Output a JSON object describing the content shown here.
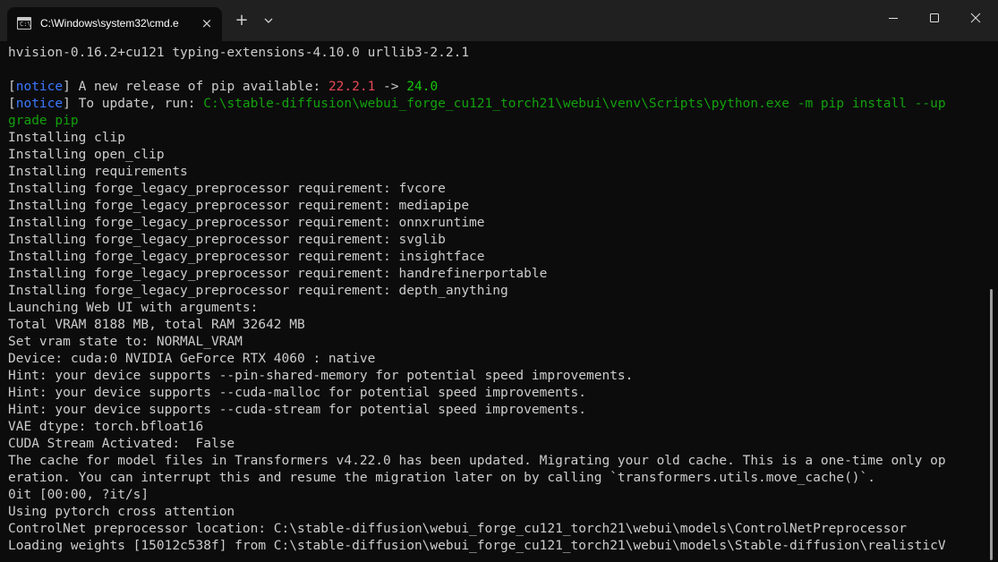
{
  "titlebar": {
    "tab_title": "C:\\Windows\\system32\\cmd.e",
    "new_tab_symbol": "+",
    "close_tab_symbol": "×"
  },
  "terminal": {
    "lines": [
      {
        "segments": [
          {
            "text": "hvision-0.16.2+cu121 typing-extensions-4.10.0 urllib3-2.2.1",
            "style": "normal"
          }
        ]
      },
      {
        "segments": []
      },
      {
        "segments": [
          {
            "text": "[",
            "style": "normal"
          },
          {
            "text": "notice",
            "style": "notice"
          },
          {
            "text": "] A new release of pip available: ",
            "style": "normal"
          },
          {
            "text": "22.2.1",
            "style": "red"
          },
          {
            "text": " -> ",
            "style": "normal"
          },
          {
            "text": "24.0",
            "style": "green"
          }
        ]
      },
      {
        "segments": [
          {
            "text": "[",
            "style": "normal"
          },
          {
            "text": "notice",
            "style": "notice"
          },
          {
            "text": "] To update, run: ",
            "style": "normal"
          },
          {
            "text": "C:\\stable-diffusion\\webui_forge_cu121_torch21\\webui\\venv\\Scripts\\python.exe -m pip install --up",
            "style": "cmd"
          }
        ]
      },
      {
        "segments": [
          {
            "text": "grade pip",
            "style": "cmd"
          }
        ]
      },
      {
        "segments": [
          {
            "text": "Installing clip",
            "style": "normal"
          }
        ]
      },
      {
        "segments": [
          {
            "text": "Installing open_clip",
            "style": "normal"
          }
        ]
      },
      {
        "segments": [
          {
            "text": "Installing requirements",
            "style": "normal"
          }
        ]
      },
      {
        "segments": [
          {
            "text": "Installing forge_legacy_preprocessor requirement: fvcore",
            "style": "normal"
          }
        ]
      },
      {
        "segments": [
          {
            "text": "Installing forge_legacy_preprocessor requirement: mediapipe",
            "style": "normal"
          }
        ]
      },
      {
        "segments": [
          {
            "text": "Installing forge_legacy_preprocessor requirement: onnxruntime",
            "style": "normal"
          }
        ]
      },
      {
        "segments": [
          {
            "text": "Installing forge_legacy_preprocessor requirement: svglib",
            "style": "normal"
          }
        ]
      },
      {
        "segments": [
          {
            "text": "Installing forge_legacy_preprocessor requirement: insightface",
            "style": "normal"
          }
        ]
      },
      {
        "segments": [
          {
            "text": "Installing forge_legacy_preprocessor requirement: handrefinerportable",
            "style": "normal"
          }
        ]
      },
      {
        "segments": [
          {
            "text": "Installing forge_legacy_preprocessor requirement: depth_anything",
            "style": "normal"
          }
        ]
      },
      {
        "segments": [
          {
            "text": "Launching Web UI with arguments:",
            "style": "normal"
          }
        ]
      },
      {
        "segments": [
          {
            "text": "Total VRAM 8188 MB, total RAM 32642 MB",
            "style": "normal"
          }
        ]
      },
      {
        "segments": [
          {
            "text": "Set vram state to: NORMAL_VRAM",
            "style": "normal"
          }
        ]
      },
      {
        "segments": [
          {
            "text": "Device: cuda:0 NVIDIA GeForce RTX 4060 : native",
            "style": "normal"
          }
        ]
      },
      {
        "segments": [
          {
            "text": "Hint: your device supports --pin-shared-memory for potential speed improvements.",
            "style": "normal"
          }
        ]
      },
      {
        "segments": [
          {
            "text": "Hint: your device supports --cuda-malloc for potential speed improvements.",
            "style": "normal"
          }
        ]
      },
      {
        "segments": [
          {
            "text": "Hint: your device supports --cuda-stream for potential speed improvements.",
            "style": "normal"
          }
        ]
      },
      {
        "segments": [
          {
            "text": "VAE dtype: torch.bfloat16",
            "style": "normal"
          }
        ]
      },
      {
        "segments": [
          {
            "text": "CUDA Stream Activated:  False",
            "style": "normal"
          }
        ]
      },
      {
        "segments": [
          {
            "text": "The cache for model files in Transformers v4.22.0 has been updated. Migrating your old cache. This is a one-time only op",
            "style": "normal"
          }
        ]
      },
      {
        "segments": [
          {
            "text": "eration. You can interrupt this and resume the migration later on by calling `transformers.utils.move_cache()`.",
            "style": "normal"
          }
        ]
      },
      {
        "segments": [
          {
            "text": "0it [00:00, ?it/s]",
            "style": "normal"
          }
        ]
      },
      {
        "segments": [
          {
            "text": "Using pytorch cross attention",
            "style": "normal"
          }
        ]
      },
      {
        "segments": [
          {
            "text": "ControlNet preprocessor location: C:\\stable-diffusion\\webui_forge_cu121_torch21\\webui\\models\\ControlNetPreprocessor",
            "style": "normal"
          }
        ]
      },
      {
        "segments": [
          {
            "text": "Loading weights [15012c538f] from C:\\stable-diffusion\\webui_forge_cu121_torch21\\webui\\models\\Stable-diffusion\\realisticV",
            "style": "normal"
          }
        ]
      }
    ]
  },
  "colors": {
    "background": "#0c0c0c",
    "titlebar": "#202020",
    "text": "#cccccc",
    "notice": "#3b78ff",
    "red": "#e74856",
    "green": "#16c60c",
    "command": "#13a10e"
  }
}
